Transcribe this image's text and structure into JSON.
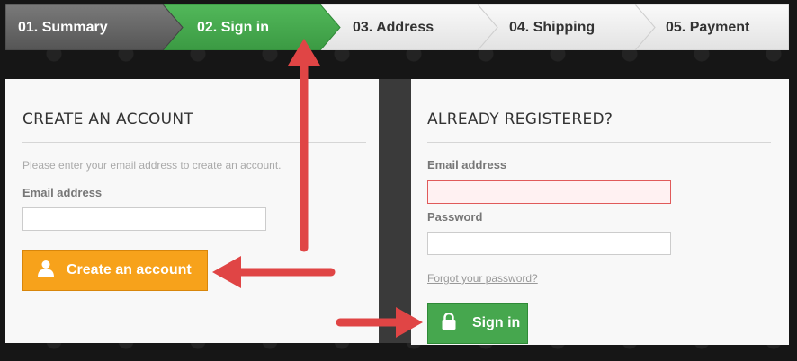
{
  "steps": [
    {
      "label": "01. Summary",
      "state": "done"
    },
    {
      "label": "02. Sign in",
      "state": "current"
    },
    {
      "label": "03. Address",
      "state": "todo"
    },
    {
      "label": "04. Shipping",
      "state": "todo"
    },
    {
      "label": "05. Payment",
      "state": "todo"
    }
  ],
  "create_account": {
    "title": "CREATE AN ACCOUNT",
    "hint": "Please enter your email address to create an account.",
    "email_label": "Email address",
    "email_value": "",
    "button_label": "Create an account"
  },
  "login": {
    "title": "ALREADY REGISTERED?",
    "email_label": "Email address",
    "email_value": "",
    "password_label": "Password",
    "password_value": "",
    "forgot_link": "Forgot your password?",
    "button_label": "Sign in"
  },
  "colors": {
    "step_done": "#6b6b6b",
    "step_current": "#46a74e",
    "step_todo": "#f0f0f0",
    "create_button": "#f7a21b",
    "sign_in_button": "#46a74e",
    "arrow": "#e04545",
    "error_field": "#fff1f2"
  },
  "icons": {
    "create_button_icon": "user-icon",
    "sign_in_button_icon": "lock-icon"
  }
}
